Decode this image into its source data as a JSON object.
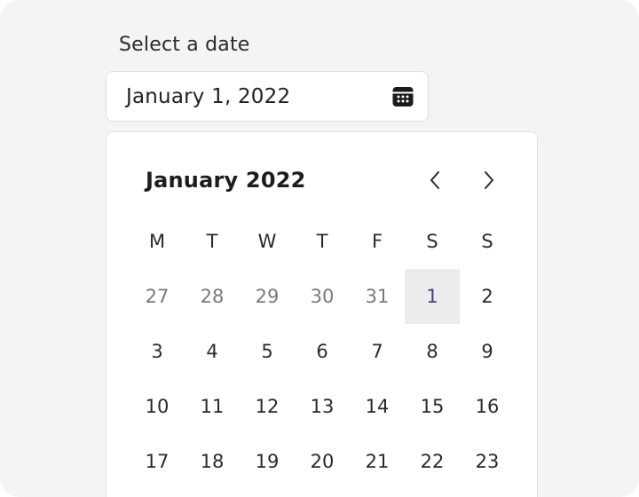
{
  "field": {
    "label": "Select a date",
    "value": "January 1, 2022"
  },
  "icons": {
    "input": "calendar-icon",
    "prev": "chevron-left-icon",
    "next": "chevron-right-icon"
  },
  "calendar": {
    "month_title": "January 2022",
    "weekdays": [
      "M",
      "T",
      "W",
      "T",
      "F",
      "S",
      "S"
    ],
    "weeks": [
      [
        {
          "label": "27",
          "outside": true
        },
        {
          "label": "28",
          "outside": true
        },
        {
          "label": "29",
          "outside": true
        },
        {
          "label": "30",
          "outside": true
        },
        {
          "label": "31",
          "outside": true
        },
        {
          "label": "1",
          "selected": true
        },
        {
          "label": "2"
        }
      ],
      [
        {
          "label": "3"
        },
        {
          "label": "4"
        },
        {
          "label": "5"
        },
        {
          "label": "6"
        },
        {
          "label": "7"
        },
        {
          "label": "8"
        },
        {
          "label": "9"
        }
      ],
      [
        {
          "label": "10"
        },
        {
          "label": "11"
        },
        {
          "label": "12"
        },
        {
          "label": "13"
        },
        {
          "label": "14"
        },
        {
          "label": "15"
        },
        {
          "label": "16"
        }
      ],
      [
        {
          "label": "17"
        },
        {
          "label": "18"
        },
        {
          "label": "19"
        },
        {
          "label": "20"
        },
        {
          "label": "21"
        },
        {
          "label": "22"
        },
        {
          "label": "23"
        }
      ]
    ]
  },
  "colors": {
    "selected_bg": "#ececec",
    "selected_text": "#4a3f7a",
    "outside_text": "#7a7a7a"
  }
}
